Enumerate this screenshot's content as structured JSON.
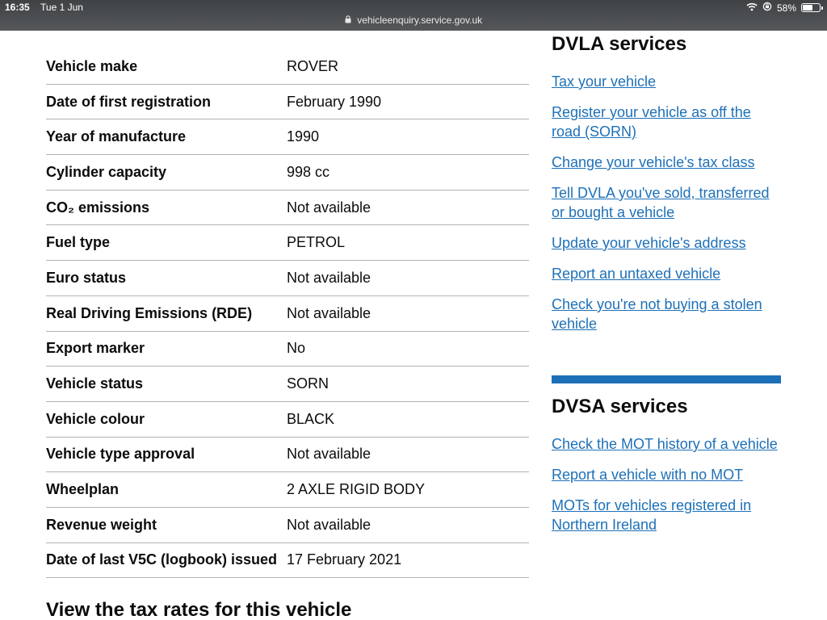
{
  "status_bar": {
    "time": "16:35",
    "date": "Tue 1 Jun",
    "url": "vehicleenquiry.service.gov.uk",
    "battery": "58%",
    "battery_level": 0.58
  },
  "vehicle_details": [
    {
      "label": "Vehicle make",
      "value": "ROVER"
    },
    {
      "label": "Date of first registration",
      "value": "February 1990"
    },
    {
      "label": "Year of manufacture",
      "value": "1990"
    },
    {
      "label": "Cylinder capacity",
      "value": "998 cc"
    },
    {
      "label": "CO₂ emissions",
      "value": "Not available"
    },
    {
      "label": "Fuel type",
      "value": "PETROL"
    },
    {
      "label": "Euro status",
      "value": "Not available"
    },
    {
      "label": "Real Driving Emissions (RDE)",
      "value": "Not available"
    },
    {
      "label": "Export marker",
      "value": "No"
    },
    {
      "label": "Vehicle status",
      "value": "SORN"
    },
    {
      "label": "Vehicle colour",
      "value": "BLACK"
    },
    {
      "label": "Vehicle type approval",
      "value": "Not available"
    },
    {
      "label": "Wheelplan",
      "value": "2 AXLE RIGID BODY"
    },
    {
      "label": "Revenue weight",
      "value": "Not available"
    },
    {
      "label": "Date of last V5C (logbook) issued",
      "value": "17 February 2021"
    }
  ],
  "tax_rates_heading": "View the tax rates for this vehicle",
  "dvla": {
    "heading": "DVLA services",
    "links": [
      "Tax your vehicle",
      "Register your vehicle as off the road (SORN)",
      "Change your vehicle's tax class",
      "Tell DVLA you've sold, transferred or bought a vehicle",
      "Update your vehicle's address",
      "Report an untaxed vehicle",
      "Check you're not buying a stolen vehicle"
    ]
  },
  "dvsa": {
    "heading": "DVSA services",
    "links": [
      "Check the MOT history of a vehicle",
      "Report a vehicle with no MOT",
      "MOTs for vehicles registered in Northern Ireland"
    ]
  },
  "colors": {
    "link": "#1d70b8",
    "divider": "#b1b4b6",
    "text": "#0b0c0c"
  },
  "icons": [
    "lock-icon",
    "wifi-icon",
    "orientation-lock-icon",
    "battery-icon"
  ]
}
